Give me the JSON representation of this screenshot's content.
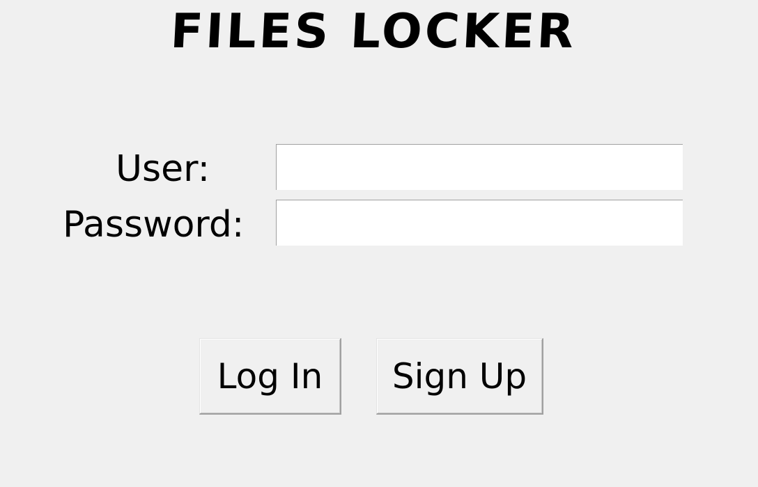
{
  "app": {
    "title": "FILES LOCKER"
  },
  "form": {
    "user_label": "User:",
    "user_value": "",
    "password_label": "Password:",
    "password_value": ""
  },
  "buttons": {
    "login_label": "Log In",
    "signup_label": "Sign Up"
  }
}
